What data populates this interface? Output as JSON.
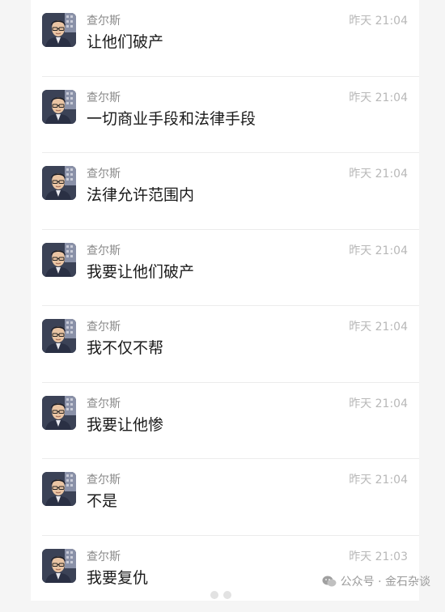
{
  "colors": {
    "background": "#f5f5f5",
    "panel": "#ffffff",
    "name": "#8a8a8a",
    "time": "#b8b8b8",
    "text": "#1a1a1a",
    "divider": "#ececec"
  },
  "messages": [
    {
      "name": "查尔斯",
      "time": "昨天 21:04",
      "text": "让他们破产",
      "avatar_icon": "user-avatar-icon"
    },
    {
      "name": "查尔斯",
      "time": "昨天 21:04",
      "text": "一切商业手段和法律手段",
      "avatar_icon": "user-avatar-icon"
    },
    {
      "name": "查尔斯",
      "time": "昨天 21:04",
      "text": "法律允许范围内",
      "avatar_icon": "user-avatar-icon"
    },
    {
      "name": "查尔斯",
      "time": "昨天 21:04",
      "text": "我要让他们破产",
      "avatar_icon": "user-avatar-icon"
    },
    {
      "name": "查尔斯",
      "time": "昨天 21:04",
      "text": "我不仅不帮",
      "avatar_icon": "user-avatar-icon"
    },
    {
      "name": "查尔斯",
      "time": "昨天 21:04",
      "text": "我要让他惨",
      "avatar_icon": "user-avatar-icon"
    },
    {
      "name": "查尔斯",
      "time": "昨天 21:04",
      "text": "不是",
      "avatar_icon": "user-avatar-icon"
    },
    {
      "name": "查尔斯",
      "time": "昨天 21:03",
      "text": "我要复仇",
      "avatar_icon": "user-avatar-icon"
    }
  ],
  "watermark": {
    "text": "公众号 · 金石杂谈",
    "icon": "wechat-icon"
  }
}
